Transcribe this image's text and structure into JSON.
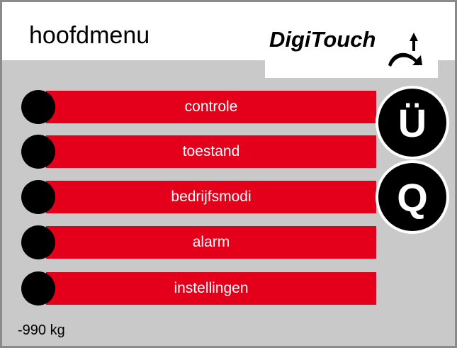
{
  "header": {
    "title": "hoofdmenu",
    "logo_text": "DigiTouch"
  },
  "menu": {
    "items": [
      {
        "label": "controle"
      },
      {
        "label": "toestand"
      },
      {
        "label": "bedrijfsmodi"
      },
      {
        "label": "alarm"
      },
      {
        "label": "instellingen"
      }
    ]
  },
  "side_buttons": {
    "umlaut_u": "Ü",
    "q": "Q"
  },
  "status": {
    "weight": "-990 kg"
  },
  "colors": {
    "button_red": "#e4001b",
    "background_gray": "#c9c9c9"
  },
  "icons": {
    "logo_mark": "digitouch-swoosh-icon",
    "bullet": "circle-bullet-icon"
  }
}
